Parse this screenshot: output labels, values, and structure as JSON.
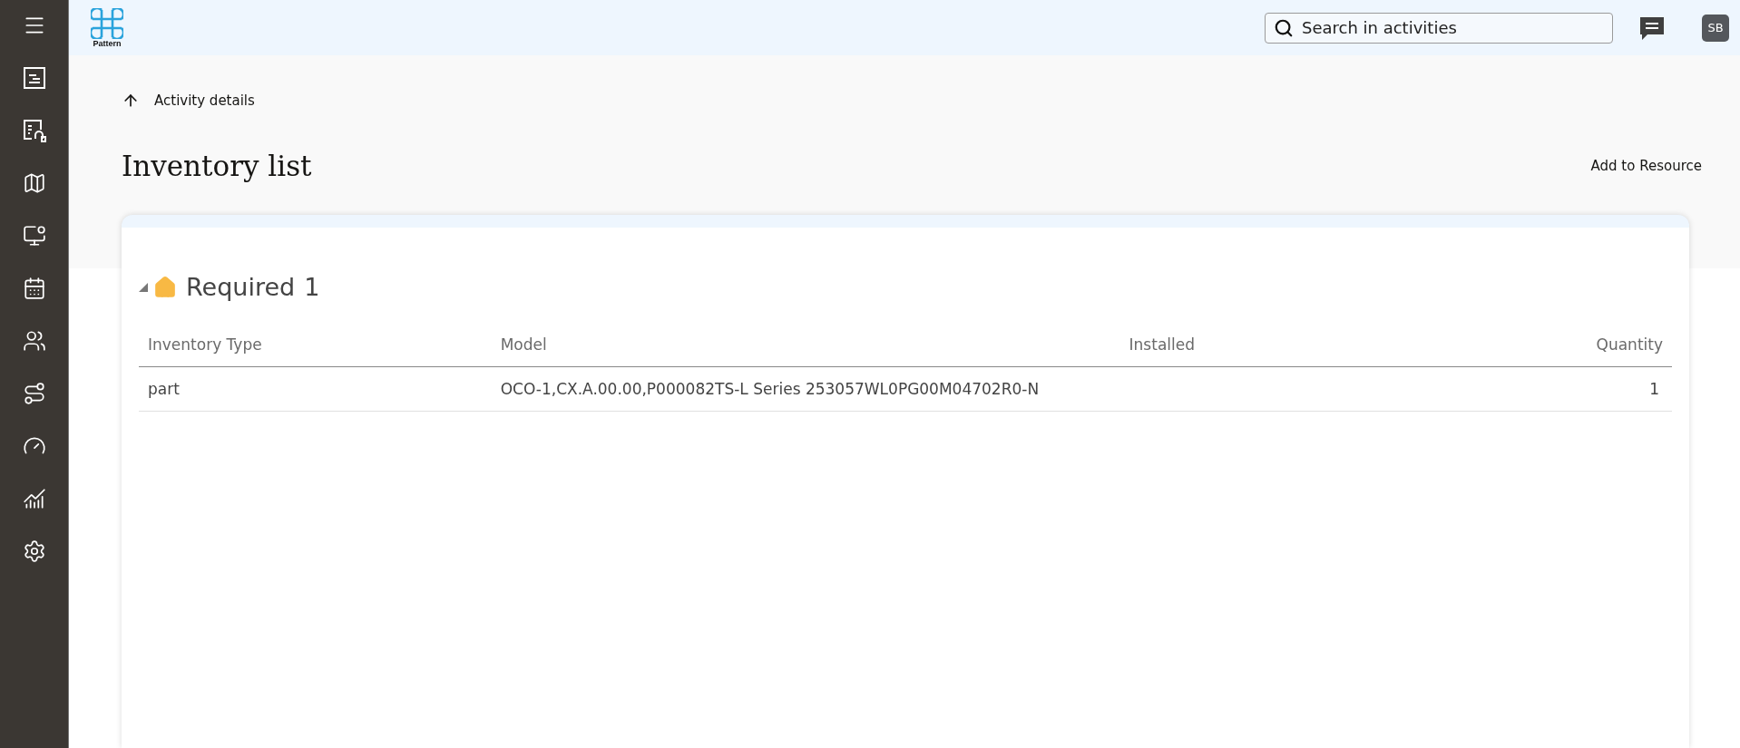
{
  "header": {
    "logo_text": "Pattern",
    "search": {
      "placeholder": "Search in activities"
    },
    "avatar": "SB"
  },
  "back_link": "Activity details",
  "title": "Inventory list",
  "action": "Add to Resource",
  "section": {
    "title": "Required",
    "count": "1",
    "expanded": true,
    "columns": [
      {
        "label": "Inventory Type",
        "kind": "text"
      },
      {
        "label": "Model",
        "kind": "text"
      },
      {
        "label": "Installed",
        "kind": "text"
      },
      {
        "label": "Quantity",
        "kind": "number"
      }
    ],
    "rows": [
      [
        "part",
        "OCO-1,CX.A.00.00,P000082TS-L Series 253057WL0PG00M04702R0-N",
        "",
        "1"
      ]
    ]
  }
}
